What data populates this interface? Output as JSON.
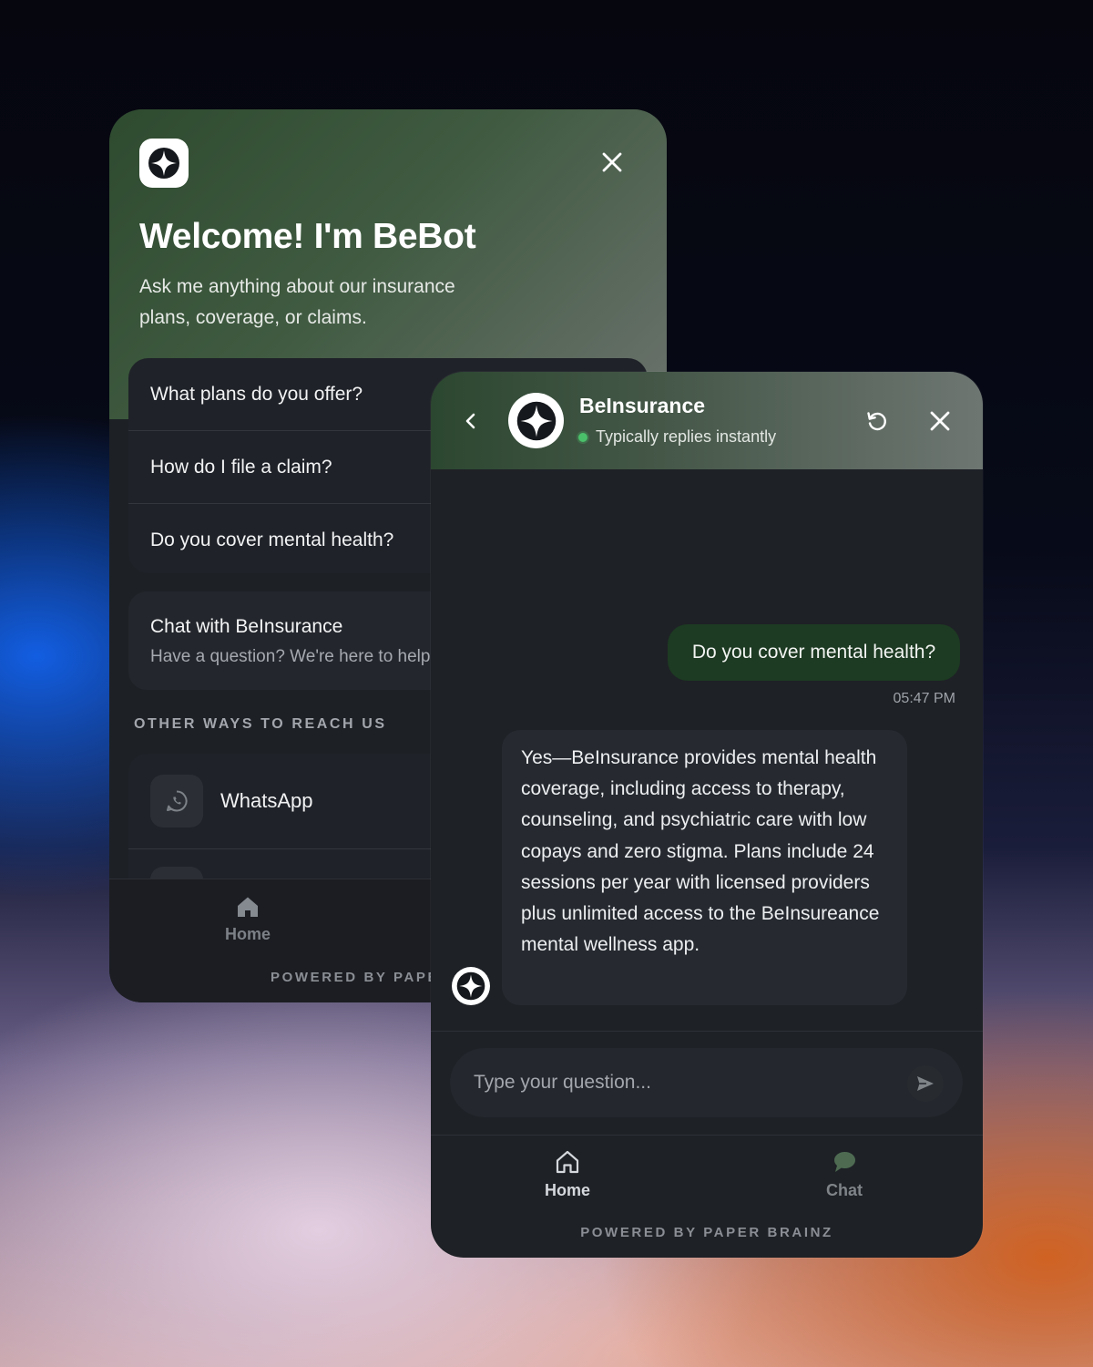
{
  "welcome_panel": {
    "title": "Welcome! I'm BeBot",
    "subtitle": "Ask me anything about our insurance plans, coverage, or claims.",
    "quick_questions": [
      "What plans do you offer?",
      "How do I file a claim?",
      "Do you cover mental health?"
    ],
    "chat_card": {
      "title": "Chat with BeInsurance",
      "subtitle": "Have a question? We're here to help"
    },
    "other_ways_heading": "OTHER WAYS TO REACH US",
    "contacts": [
      "WhatsApp"
    ],
    "nav": {
      "home_label": "Home"
    },
    "powered_by": "POWERED BY PAPER BRAINZ"
  },
  "chat_panel": {
    "brand_name": "BeInsurance",
    "status_text": "Typically replies instantly",
    "messages": [
      {
        "from": "user",
        "text": "Do you cover mental health?",
        "time": "05:47 PM"
      },
      {
        "from": "bot",
        "text": "Yes—BeInsurance provides mental health coverage, including access to therapy, counseling, and psychiatric care with low copays and zero stigma. Plans include 24 sessions per year with licensed providers plus unlimited access to the BeInsureance mental wellness app."
      }
    ],
    "input": {
      "placeholder": "Type your question...",
      "value": ""
    },
    "nav": {
      "home_label": "Home",
      "chat_label": "Chat"
    },
    "powered_by": "POWERED BY PAPER BRAINZ"
  },
  "colors": {
    "brand_green": "#2e4a2f",
    "user_bubble": "#1d3a22",
    "online_dot": "#4ac06a",
    "panel_bg": "#1e2126"
  },
  "icons": [
    "bebot-logo-icon",
    "close-icon",
    "back-chevron-icon",
    "refresh-icon",
    "whatsapp-icon",
    "home-icon",
    "chat-bubble-icon",
    "send-icon"
  ]
}
